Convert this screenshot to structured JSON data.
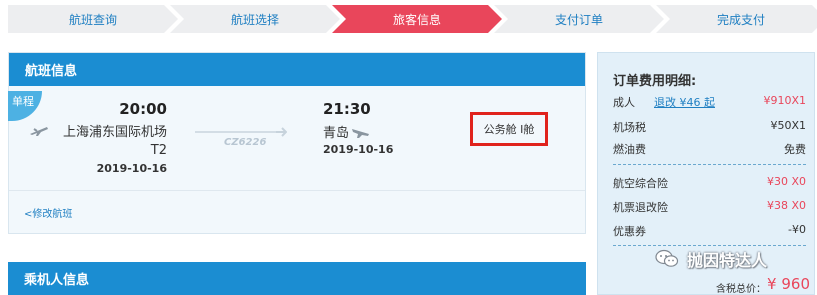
{
  "steps": [
    {
      "label": "航班查询"
    },
    {
      "label": "航班选择"
    },
    {
      "label": "旅客信息"
    },
    {
      "label": "支付订单"
    },
    {
      "label": "完成支付"
    }
  ],
  "flight_panel": {
    "title": "航班信息",
    "badge": "单程",
    "departure": {
      "time": "20:00",
      "airport": "上海浦东国际机场",
      "terminal": "T2",
      "date": "2019-10-16"
    },
    "flight_no": "CZ6226",
    "arrival": {
      "time": "21:30",
      "city": "青岛",
      "date": "2019-10-16"
    },
    "cabin": "公务舱 I舱",
    "modify_link": "<修改航班"
  },
  "passenger_panel": {
    "title": "乘机人信息"
  },
  "fees": {
    "title": "订单费用明细:",
    "rows": [
      {
        "label": "成人",
        "link": "退改 ¥46 起",
        "value": "¥910X1"
      },
      {
        "label": "机场税",
        "value": "¥50X1"
      },
      {
        "label": "燃油费",
        "value": "免费"
      },
      {
        "label": "航空综合险",
        "value": "¥30 X0"
      },
      {
        "label": "机票退改险",
        "value": "¥38 X0"
      },
      {
        "label": "优惠券",
        "value": "-¥0"
      }
    ],
    "total_label": "含税总价：",
    "total_value": "¥ 960"
  },
  "watermark": "抛因特达人",
  "icons": {
    "departure": "plane-takeoff-icon",
    "arrival": "plane-landing-icon",
    "flight_arrow": "arrow-right-icon",
    "watermark_logo": "wechat-icon"
  },
  "colors": {
    "primary_blue": "#1b8dd2",
    "active_step": "#e9465b",
    "highlight_box": "#e0231d",
    "price_red": "#e9465b"
  }
}
